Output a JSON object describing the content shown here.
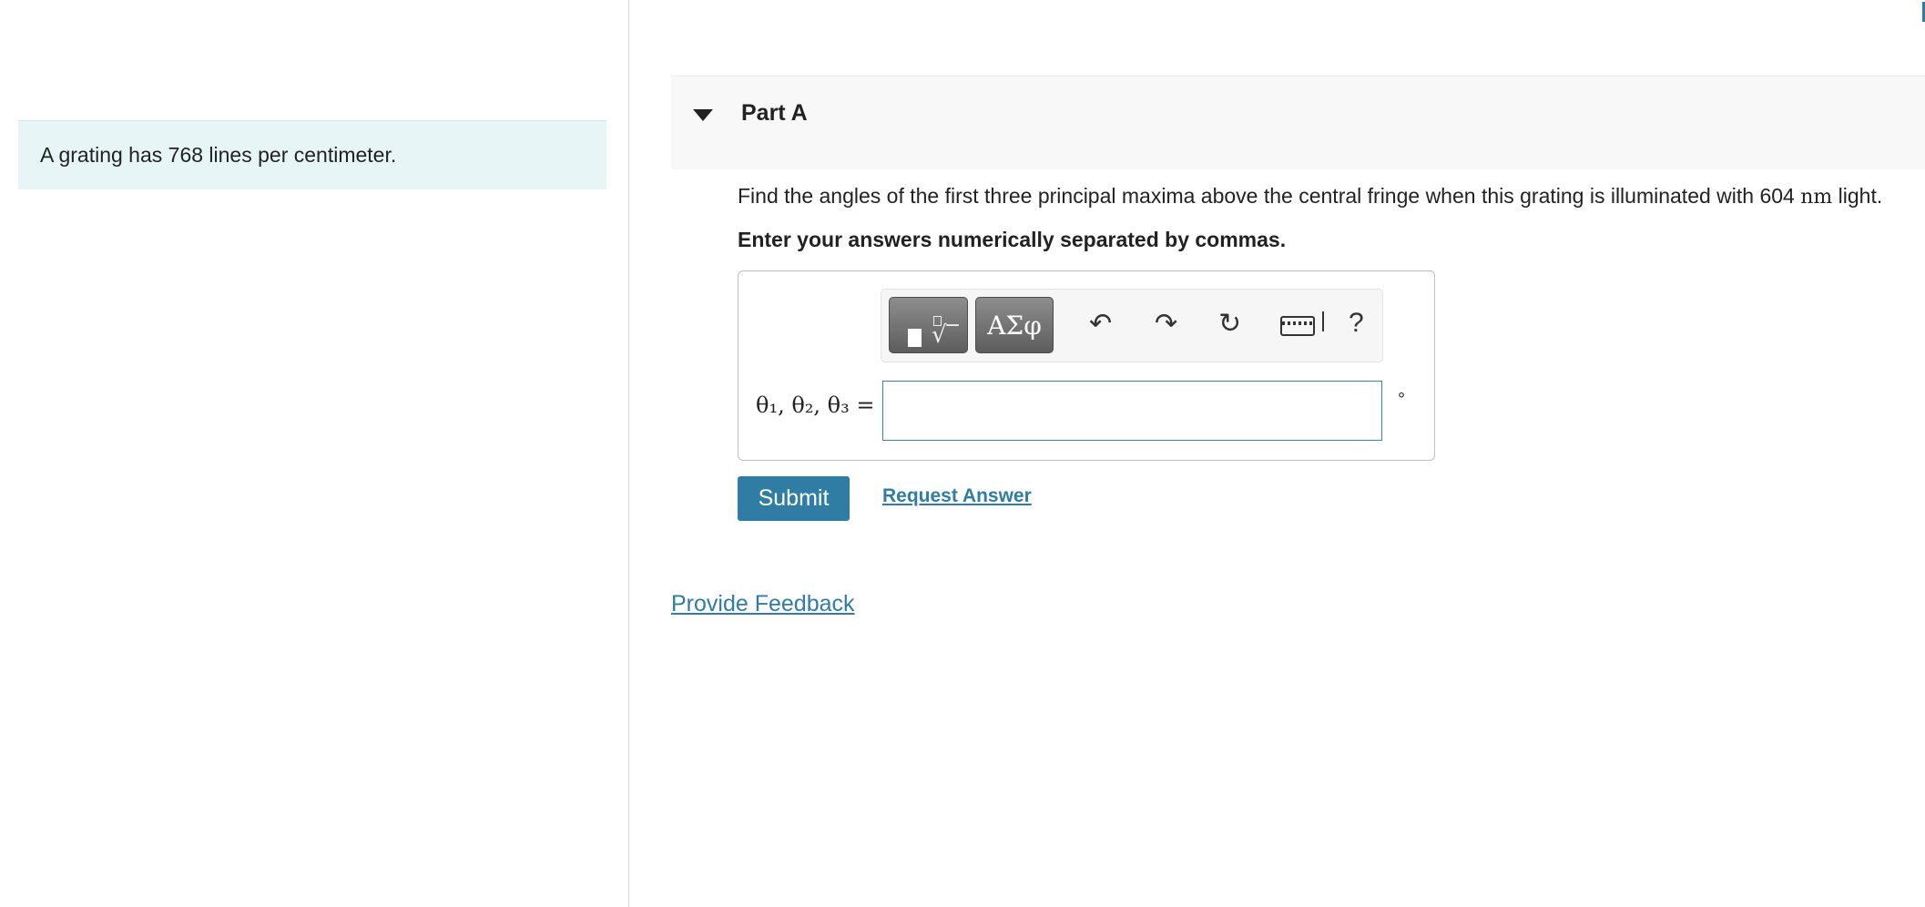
{
  "intro": {
    "text": "A grating has 768 lines per centimeter."
  },
  "part": {
    "title": "Part A"
  },
  "question": {
    "text_before": "Find the angles of the first three principal maxima above the central fringe when this grating is illuminated with 604 ",
    "unit": "nm",
    "text_after": " light.",
    "instruction": "Enter your answers numerically separated by commas."
  },
  "toolbar": {
    "greek_label": "ΑΣφ",
    "help_label": "?",
    "icons": [
      "templates-icon",
      "greek-letters-icon",
      "undo-icon",
      "redo-icon",
      "reset-icon",
      "keyboard-icon",
      "help-icon"
    ]
  },
  "answer": {
    "label": "θ₁, θ₂, θ₃ =",
    "value": "",
    "unit_symbol": "°"
  },
  "actions": {
    "submit_label": "Submit",
    "request_answer_label": "Request Answer",
    "feedback_label": "Provide Feedback"
  },
  "colors": {
    "accent": "#2f7da4",
    "intro_bg": "#e8f5f7",
    "part_header_bg": "#f8f8f8"
  }
}
